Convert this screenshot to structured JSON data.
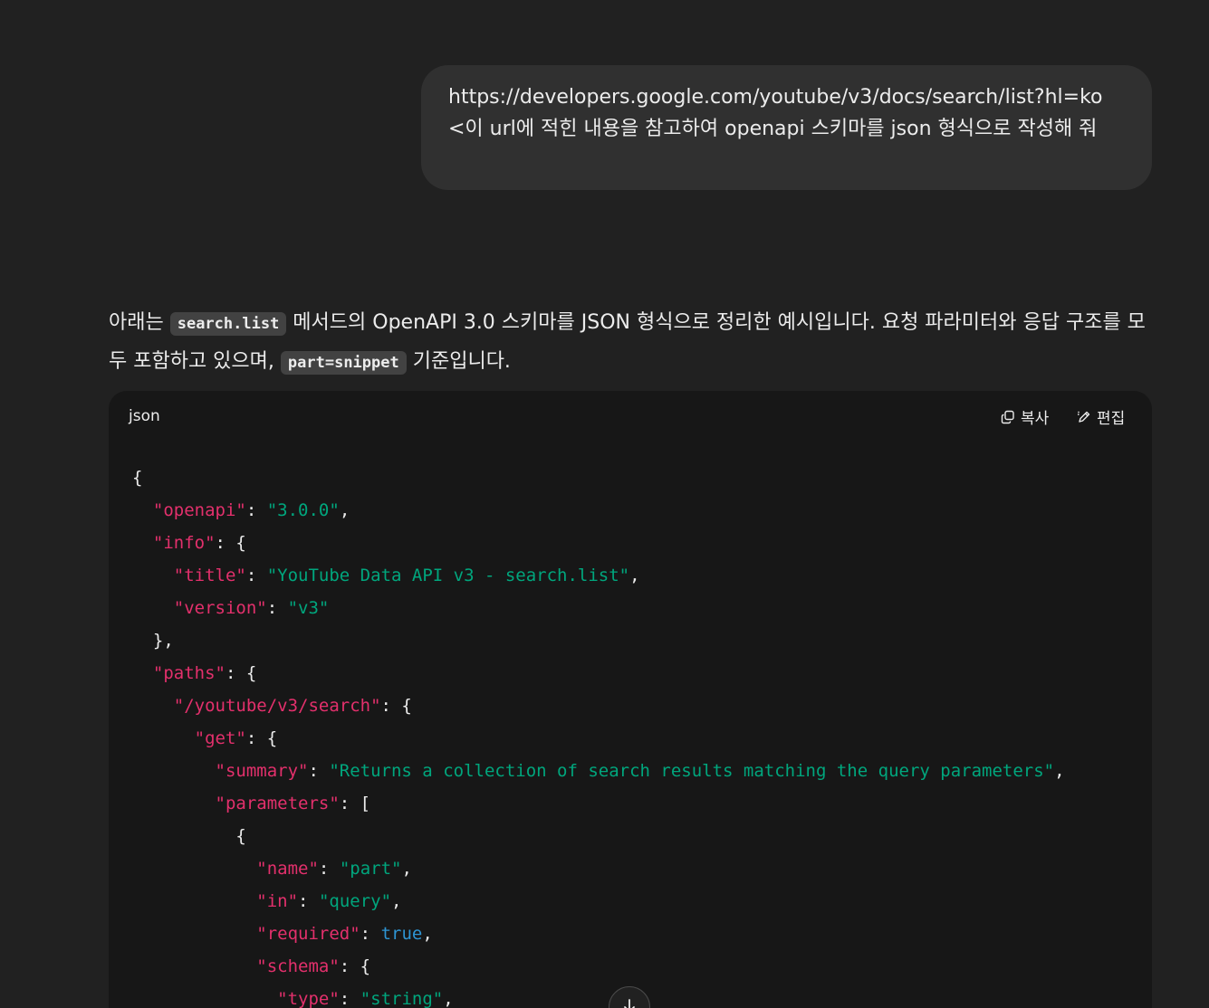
{
  "user_message": {
    "text": "https://developers.google.com/youtube/v3/docs/search/list?hl=ko <이 url에 적힌 내용을 참고하여 openapi 스키마를 json 형식으로 작성해 줘"
  },
  "assistant": {
    "intro_part1": "아래는 ",
    "inline_code_1": "search.list",
    "intro_part2": " 메서드의 OpenAPI 3.0 스키마를 JSON 형식으로 정리한 예시입니다. 요청 파라미터와 응답 구조를 모두 포함하고 있으며, ",
    "inline_code_2": "part=snippet",
    "intro_part3": " 기준입니다."
  },
  "code_block": {
    "language": "json",
    "copy_label": "복사",
    "edit_label": "편집",
    "lines": [
      [
        {
          "t": "p",
          "v": "{"
        }
      ],
      [
        {
          "t": "p",
          "v": "  "
        },
        {
          "t": "k",
          "v": "\"openapi\""
        },
        {
          "t": "p",
          "v": ": "
        },
        {
          "t": "s",
          "v": "\"3.0.0\""
        },
        {
          "t": "p",
          "v": ","
        }
      ],
      [
        {
          "t": "p",
          "v": "  "
        },
        {
          "t": "k",
          "v": "\"info\""
        },
        {
          "t": "p",
          "v": ": {"
        }
      ],
      [
        {
          "t": "p",
          "v": "    "
        },
        {
          "t": "k",
          "v": "\"title\""
        },
        {
          "t": "p",
          "v": ": "
        },
        {
          "t": "s",
          "v": "\"YouTube Data API v3 - search.list\""
        },
        {
          "t": "p",
          "v": ","
        }
      ],
      [
        {
          "t": "p",
          "v": "    "
        },
        {
          "t": "k",
          "v": "\"version\""
        },
        {
          "t": "p",
          "v": ": "
        },
        {
          "t": "s",
          "v": "\"v3\""
        }
      ],
      [
        {
          "t": "p",
          "v": "  },"
        }
      ],
      [
        {
          "t": "p",
          "v": "  "
        },
        {
          "t": "k",
          "v": "\"paths\""
        },
        {
          "t": "p",
          "v": ": {"
        }
      ],
      [
        {
          "t": "p",
          "v": "    "
        },
        {
          "t": "k",
          "v": "\"/youtube/v3/search\""
        },
        {
          "t": "p",
          "v": ": {"
        }
      ],
      [
        {
          "t": "p",
          "v": "      "
        },
        {
          "t": "k",
          "v": "\"get\""
        },
        {
          "t": "p",
          "v": ": {"
        }
      ],
      [
        {
          "t": "p",
          "v": "        "
        },
        {
          "t": "k",
          "v": "\"summary\""
        },
        {
          "t": "p",
          "v": ": "
        },
        {
          "t": "s",
          "v": "\"Returns a collection of search results matching the query parameters\""
        },
        {
          "t": "p",
          "v": ","
        }
      ],
      [
        {
          "t": "p",
          "v": "        "
        },
        {
          "t": "k",
          "v": "\"parameters\""
        },
        {
          "t": "p",
          "v": ": ["
        }
      ],
      [
        {
          "t": "p",
          "v": "          {"
        }
      ],
      [
        {
          "t": "p",
          "v": "            "
        },
        {
          "t": "k",
          "v": "\"name\""
        },
        {
          "t": "p",
          "v": ": "
        },
        {
          "t": "s",
          "v": "\"part\""
        },
        {
          "t": "p",
          "v": ","
        }
      ],
      [
        {
          "t": "p",
          "v": "            "
        },
        {
          "t": "k",
          "v": "\"in\""
        },
        {
          "t": "p",
          "v": ": "
        },
        {
          "t": "s",
          "v": "\"query\""
        },
        {
          "t": "p",
          "v": ","
        }
      ],
      [
        {
          "t": "p",
          "v": "            "
        },
        {
          "t": "k",
          "v": "\"required\""
        },
        {
          "t": "p",
          "v": ": "
        },
        {
          "t": "b",
          "v": "true"
        },
        {
          "t": "p",
          "v": ","
        }
      ],
      [
        {
          "t": "p",
          "v": "            "
        },
        {
          "t": "k",
          "v": "\"schema\""
        },
        {
          "t": "p",
          "v": ": {"
        }
      ],
      [
        {
          "t": "p",
          "v": "              "
        },
        {
          "t": "k",
          "v": "\"type\""
        },
        {
          "t": "p",
          "v": ": "
        },
        {
          "t": "s",
          "v": "\"string\""
        },
        {
          "t": "p",
          "v": ","
        }
      ]
    ]
  },
  "colors": {
    "background": "#212121",
    "user_bubble": "#303030",
    "code_background": "#171717",
    "json_key": "#e3306c",
    "json_string": "#00a67d",
    "json_boolean": "#2e95d3"
  },
  "icons": {
    "copy": "copy-icon",
    "edit": "edit-pencil-icon",
    "scroll_down": "arrow-down-icon"
  }
}
